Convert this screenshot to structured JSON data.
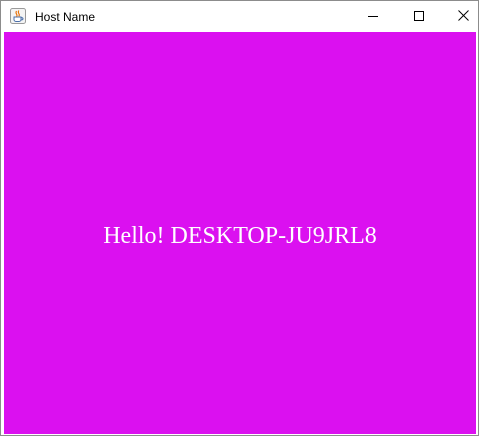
{
  "window": {
    "title": "Host Name",
    "app_icon": "java-coffee-cup-icon",
    "controls": {
      "minimize_icon": "minimize-icon",
      "maximize_icon": "maximize-icon",
      "close_icon": "close-icon"
    }
  },
  "content": {
    "message": "Hello! DESKTOP-JU9JRL8",
    "background_color": "#db10f0",
    "text_color": "#ffffff"
  }
}
